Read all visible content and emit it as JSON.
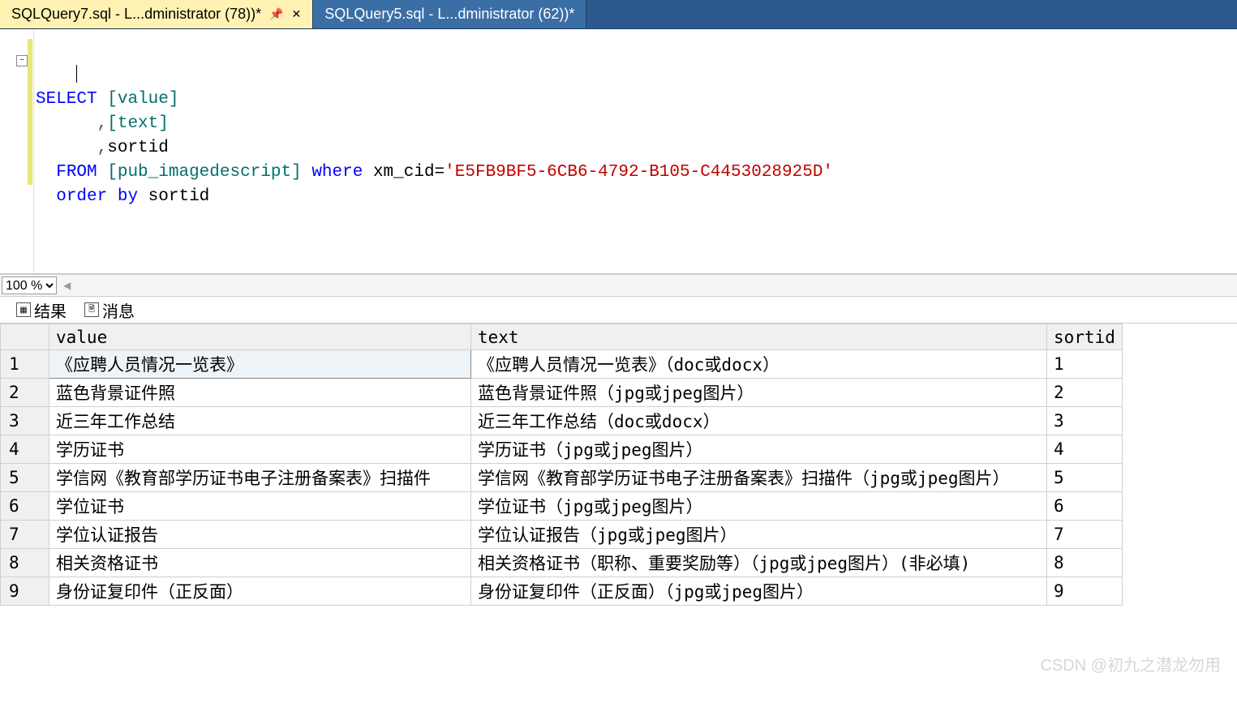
{
  "tabs": [
    {
      "label": "SQLQuery7.sql - L...dministrator (78))*",
      "active": true
    },
    {
      "label": "SQLQuery5.sql - L...dministrator (62))*",
      "active": false
    }
  ],
  "sql": {
    "select": "SELECT",
    "col1": "[value]",
    "comma": ",",
    "col2": "[text]",
    "col3": "sortid",
    "from": "FROM",
    "table": "[pub_imagedescript]",
    "where": "where",
    "wherecol": "xm_cid=",
    "guid": "'E5FB9BF5-6CB6-4792-B105-C4453028925D'",
    "order": "order",
    "by": "by",
    "ordercol": "sortid"
  },
  "zoom": "100 %",
  "result_tabs": {
    "results": "结果",
    "messages": "消息"
  },
  "columns": {
    "value": "value",
    "text": "text",
    "sortid": "sortid"
  },
  "rows": [
    {
      "n": "1",
      "value": "《应聘人员情况一览表》",
      "text": "《应聘人员情况一览表》（doc或docx）",
      "sortid": "1"
    },
    {
      "n": "2",
      "value": "蓝色背景证件照",
      "text": "蓝色背景证件照（jpg或jpeg图片）",
      "sortid": "2"
    },
    {
      "n": "3",
      "value": "近三年工作总结",
      "text": "近三年工作总结（doc或docx）",
      "sortid": "3"
    },
    {
      "n": "4",
      "value": "学历证书",
      "text": "学历证书（jpg或jpeg图片）",
      "sortid": "4"
    },
    {
      "n": "5",
      "value": "学信网《教育部学历证书电子注册备案表》扫描件",
      "text": "学信网《教育部学历证书电子注册备案表》扫描件（jpg或jpeg图片）",
      "sortid": "5"
    },
    {
      "n": "6",
      "value": "学位证书",
      "text": "学位证书（jpg或jpeg图片）",
      "sortid": "6"
    },
    {
      "n": "7",
      "value": "学位认证报告",
      "text": "学位认证报告（jpg或jpeg图片）",
      "sortid": "7"
    },
    {
      "n": "8",
      "value": "相关资格证书",
      "text": "相关资格证书（职称、重要奖励等）（jpg或jpeg图片）(非必填)",
      "sortid": "8"
    },
    {
      "n": "9",
      "value": "身份证复印件（正反面）",
      "text": "身份证复印件（正反面）（jpg或jpeg图片）",
      "sortid": "9"
    }
  ],
  "watermark": "CSDN @初九之潜龙勿用"
}
